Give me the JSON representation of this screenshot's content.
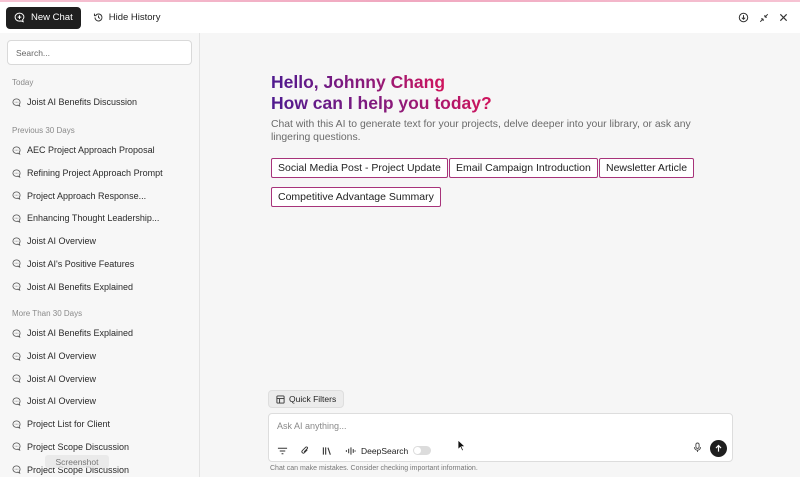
{
  "topbar": {
    "new_chat_label": "New Chat",
    "hide_history_label": "Hide History",
    "icons": [
      "chat-plus-icon",
      "history-icon",
      "download-icon",
      "collapse-icon",
      "close-icon"
    ]
  },
  "sidebar": {
    "search_placeholder": "Search...",
    "groups": [
      {
        "label": "Today",
        "items": [
          "Joist AI Benefits Discussion"
        ]
      },
      {
        "label": "Previous 30 Days",
        "items": [
          "AEC Project Approach Proposal",
          "Refining Project Approach Prompt",
          "Project Approach Response...",
          "Enhancing Thought Leadership...",
          "Joist AI Overview",
          "Joist AI's Positive Features",
          "Joist AI Benefits Explained"
        ]
      },
      {
        "label": "More Than 30 Days",
        "items": [
          "Joist AI Benefits Explained",
          "Joist AI Overview",
          "Joist AI Overview",
          "Joist AI Overview",
          "Project List for Client",
          "Project Scope Discussion",
          "Project Scope Discussion"
        ]
      }
    ]
  },
  "main": {
    "greeting_line1": "Hello, Johnny Chang",
    "greeting_line2": "How can I help you today?",
    "subtitle": "Chat with this AI to generate text for your projects, delve deeper into your library, or ask any lingering questions.",
    "suggestions": [
      "Social Media Post - Project Update",
      "Email Campaign Introduction",
      "Newsletter Article",
      "Competitive Advantage Summary"
    ],
    "quick_filters_label": "Quick Filters",
    "composer_placeholder": "Ask AI anything...",
    "deepsearch_label": "DeepSearch",
    "deepsearch_enabled": false,
    "disclaimer": "Chat can make mistakes. Consider checking important information."
  },
  "overlay": {
    "screenshot_label": "Screenshot"
  },
  "colors": {
    "accent_dark": "#1f1f1f",
    "chip_border": "#a7337a",
    "gradient_start": "#4e1a8f",
    "gradient_end": "#d0145c"
  }
}
